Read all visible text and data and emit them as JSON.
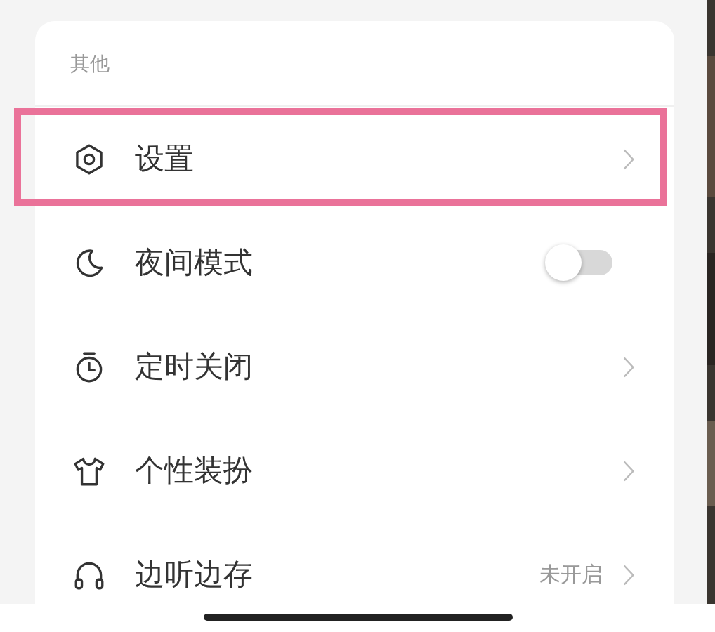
{
  "section": {
    "title": "其他"
  },
  "items": [
    {
      "kind": "link",
      "label": "设置",
      "highlighted": true
    },
    {
      "kind": "toggle",
      "label": "夜间模式",
      "on": false
    },
    {
      "kind": "link",
      "label": "定时关闭",
      "highlighted": false
    },
    {
      "kind": "link",
      "label": "个性装扮",
      "highlighted": false
    },
    {
      "kind": "status",
      "label": "边听边存",
      "value": "未开启"
    }
  ]
}
